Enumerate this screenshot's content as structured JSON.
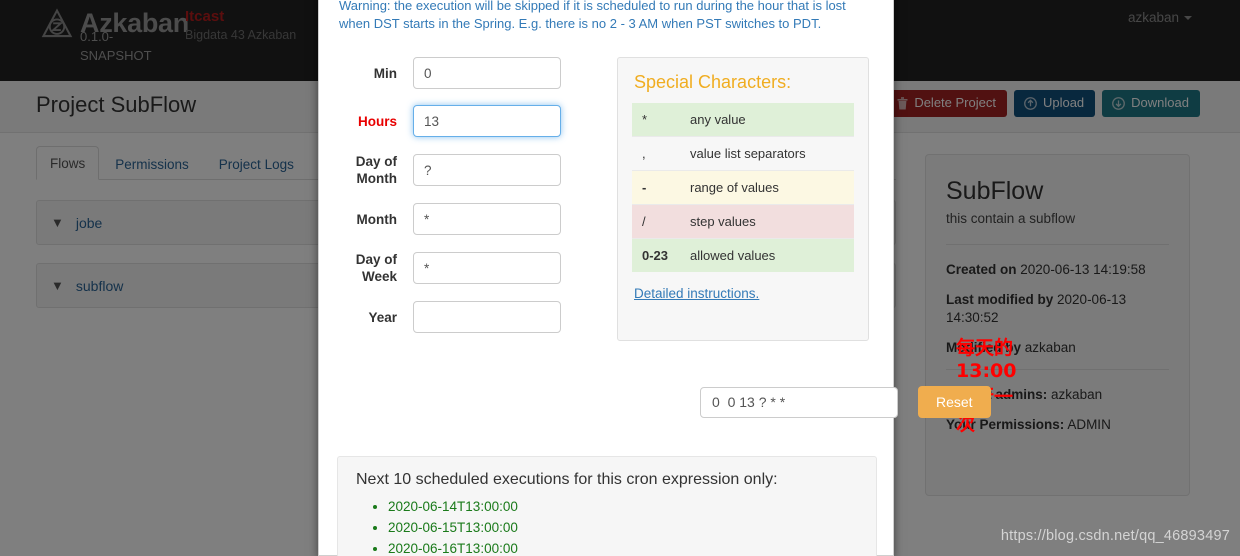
{
  "navbar": {
    "brand_name": "Azkaban",
    "brand_version": "0.1.0-SNAPSHOT",
    "project_tag": "Itcast",
    "project_subtitle": "Bigdata 43 Azkaban",
    "user": "azkaban"
  },
  "header": {
    "page_title": "Project SubFlow",
    "buttons": {
      "delete": "Delete Project",
      "upload": "Upload",
      "download": "Download"
    }
  },
  "tabs": [
    {
      "label": "Flows",
      "active": true
    },
    {
      "label": "Permissions",
      "active": false
    },
    {
      "label": "Project Logs",
      "active": false
    }
  ],
  "flows": [
    {
      "name": "jobe"
    },
    {
      "name": "subflow"
    }
  ],
  "project_card": {
    "title": "SubFlow",
    "description": "this contain a subflow",
    "created_on_label": "Created on",
    "created_on_value": "2020-06-13 14:19:58",
    "last_modified_label": "Last modified by",
    "last_modified_value": "2020-06-13 14:30:52",
    "modified_by_label": "Modified by",
    "modified_by_value": "azkaban",
    "project_admins_label": "Project admins:",
    "project_admins_value": "azkaban",
    "your_permissions_label": "Your Permissions:",
    "your_permissions_value": "ADMIN"
  },
  "modal": {
    "warning": "Warning: the execution will be skipped if it is scheduled to run during the hour that is lost when DST starts in the Spring. E.g. there is no 2 - 3 AM when PST switches to PDT.",
    "fields": [
      {
        "label": "Min",
        "value": "0",
        "required": false,
        "focused": false
      },
      {
        "label": "Hours",
        "value": "13",
        "required": true,
        "focused": true
      },
      {
        "label": "Day of Month",
        "value": "?",
        "required": false,
        "focused": false
      },
      {
        "label": "Month",
        "value": "*",
        "required": false,
        "focused": false
      },
      {
        "label": "Day of Week",
        "value": "*",
        "required": false,
        "focused": false
      },
      {
        "label": "Year",
        "value": "",
        "required": false,
        "focused": false
      }
    ],
    "special_characters": {
      "title": "Special Characters:",
      "rows": [
        {
          "key": "*",
          "desc": "any value"
        },
        {
          "key": ",",
          "desc": "value list separators"
        },
        {
          "key": "-",
          "desc": "range of values"
        },
        {
          "key": "/",
          "desc": "step values"
        },
        {
          "key": "0-23",
          "desc": "allowed values"
        }
      ],
      "link": "Detailed instructions."
    },
    "annotation_note": "每天的13:00执行一次",
    "cron_expression": "0  0 13 ? * *",
    "reset_label": "Reset",
    "next_exec_title": "Next 10 scheduled executions for this cron expression only:",
    "next_executions": [
      "2020-06-14T13:00:00",
      "2020-06-15T13:00:00",
      "2020-06-16T13:00:00"
    ]
  },
  "watermark": "https://blog.csdn.net/qq_46893497",
  "colors": {
    "navbar_bg": "#222222",
    "brand_tag": "#b71d1d",
    "accent_orange": "#f0ad4e",
    "link_blue": "#337ab7",
    "note_red": "#ff0000",
    "exec_green": "#1a7a1a",
    "danger": "#a32222",
    "primary": "#11507c",
    "info": "#1f7887"
  }
}
